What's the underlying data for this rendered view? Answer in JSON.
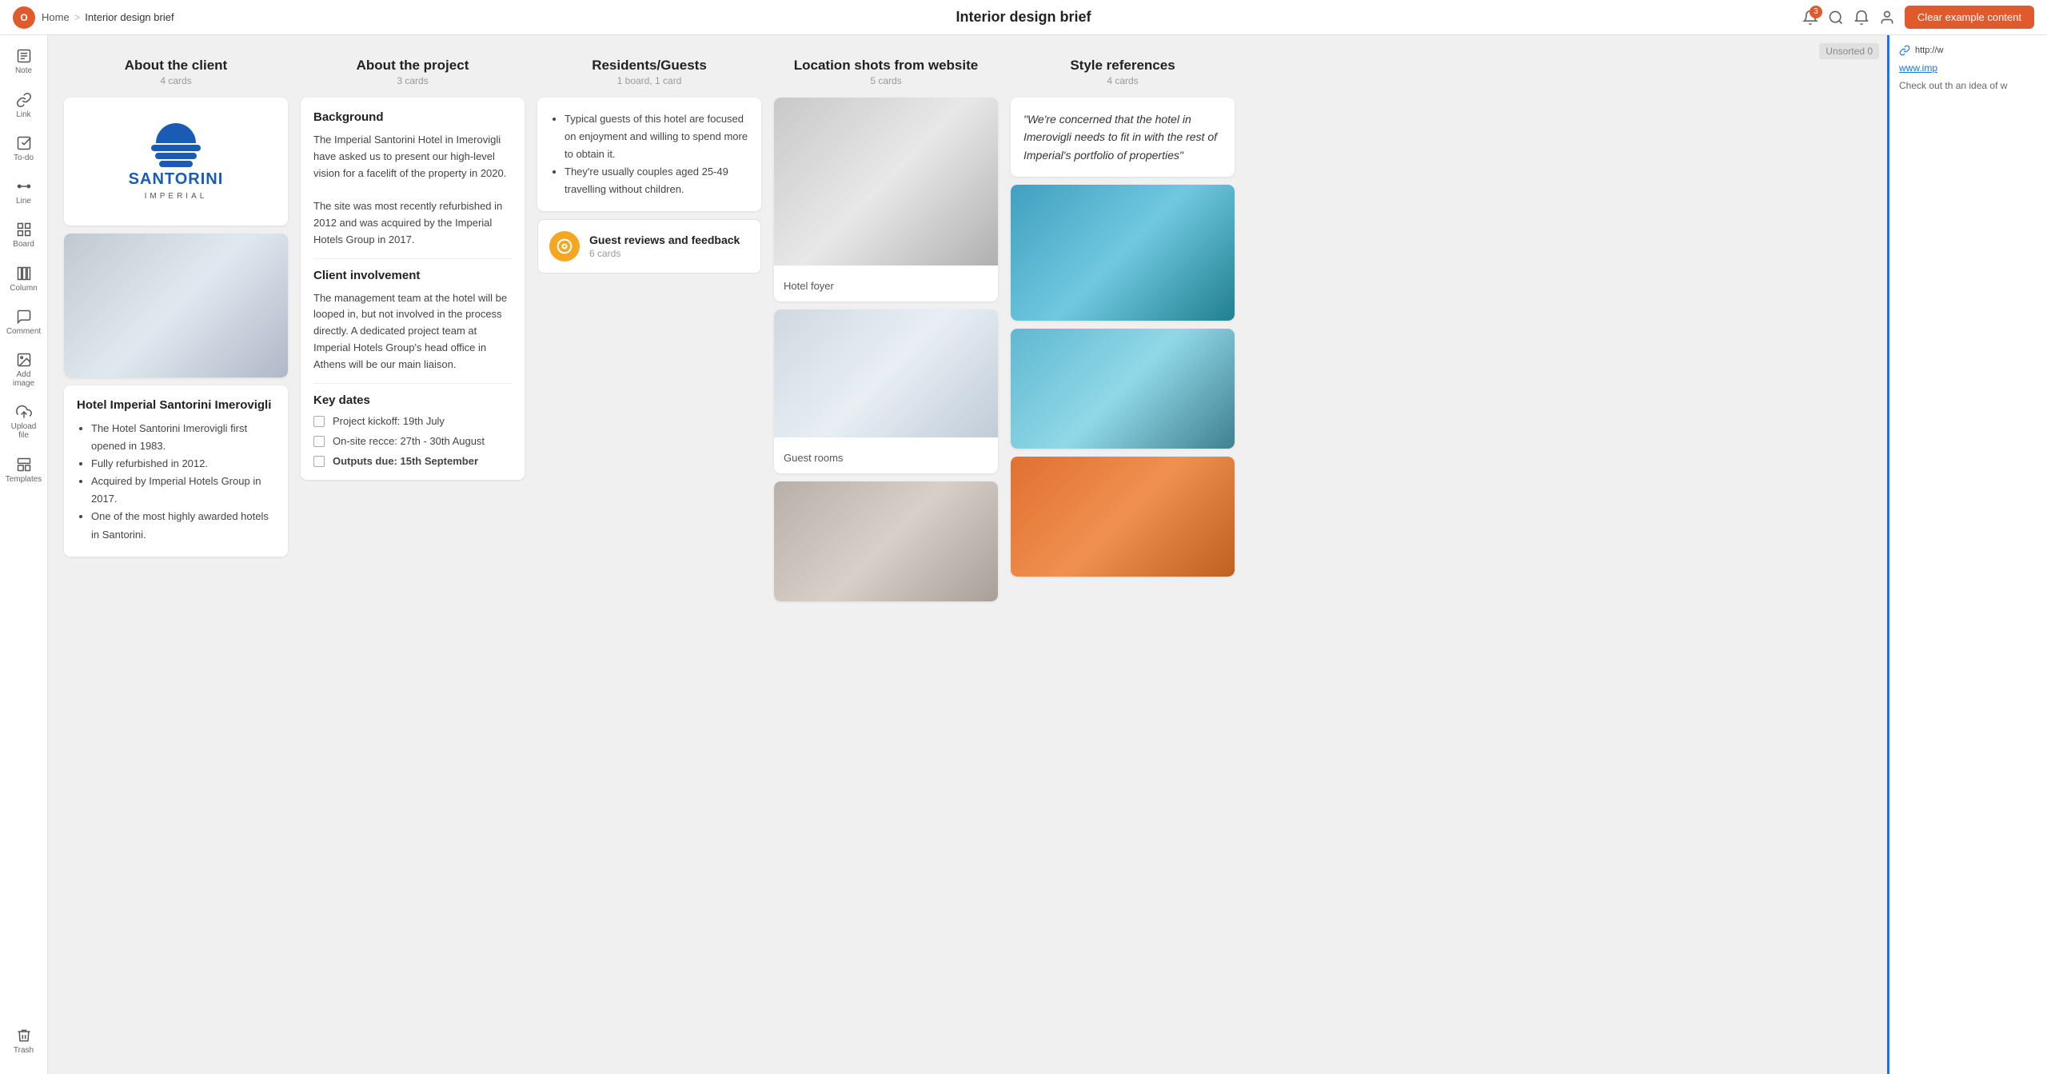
{
  "topnav": {
    "logo_text": "O",
    "breadcrumb_home": "Home",
    "breadcrumb_sep": ">",
    "breadcrumb_current": "Interior design brief",
    "page_title": "Interior design brief",
    "btn_clear_label": "Clear example content",
    "badge_count": "3"
  },
  "sidebar": {
    "items": [
      {
        "id": "note",
        "label": "Note",
        "icon": "📝"
      },
      {
        "id": "link",
        "label": "Link",
        "icon": "🔗"
      },
      {
        "id": "todo",
        "label": "To-do",
        "icon": "☑️"
      },
      {
        "id": "line",
        "label": "Line",
        "icon": "➖"
      },
      {
        "id": "board",
        "label": "Board",
        "icon": "⊞"
      },
      {
        "id": "column",
        "label": "Column",
        "icon": "▦"
      },
      {
        "id": "comment",
        "label": "Comment",
        "icon": "💬"
      },
      {
        "id": "add-image",
        "label": "Add image",
        "icon": "🖼️"
      },
      {
        "id": "upload",
        "label": "Upload file",
        "icon": "⬆️"
      },
      {
        "id": "templates",
        "label": "Templates",
        "icon": "🧩"
      }
    ],
    "trash_label": "Trash",
    "trash_icon": "🗑️"
  },
  "unsorted": "Unsorted 0",
  "columns": [
    {
      "id": "about-client",
      "title": "About the client",
      "subtitle": "4 cards",
      "cards": [
        {
          "type": "logo",
          "alt": "Santorini Imperial logo"
        },
        {
          "type": "image",
          "img_class": "img-interior",
          "label": ""
        },
        {
          "type": "text",
          "heading": "Hotel Imperial Santorini Imerovigli",
          "bullets": [
            "The Hotel Santorini Imerovigli first opened in 1983.",
            "Fully refurbished in 2012.",
            "Acquired by Imperial Hotels Group in 2017.",
            "One of the most highly awarded hotels in Santorini."
          ]
        }
      ]
    },
    {
      "id": "about-project",
      "title": "About the project",
      "subtitle": "3 cards",
      "cards": [
        {
          "type": "sections",
          "sections": [
            {
              "heading": "Background",
              "text": "The Imperial Santorini Hotel in Imerovigli have asked us to present our high-level vision for a facelift of the property in 2020.\n\nThe site was most recently refurbished in 2012 and was acquired by the Imperial Hotels Group in 2017."
            },
            {
              "heading": "Client involvement",
              "text": "The management team at the hotel will be looped in, but not involved in the process directly. A dedicated project team at Imperial Hotels Group's head office in Athens will be our main liaison."
            },
            {
              "heading": "Key dates",
              "checklist": [
                {
                  "label": "Project kickoff: 19th July",
                  "bold": false
                },
                {
                  "label": "On-site recce: 27th - 30th August",
                  "bold": false
                },
                {
                  "label": "Outputs due: 15th September",
                  "bold": true
                }
              ]
            }
          ]
        }
      ]
    },
    {
      "id": "residents-guests",
      "title": "Residents/Guests",
      "subtitle": "1 board, 1 card",
      "cards": [
        {
          "type": "bullets",
          "bullets": [
            "Typical guests of this hotel are focused on enjoyment and willing to spend more to obtain it.",
            "They're usually couples aged 25-49 travelling without children."
          ]
        },
        {
          "type": "linked",
          "icon_color": "#f5a623",
          "title": "Guest reviews and feedback",
          "subtitle": "6 cards"
        }
      ]
    },
    {
      "id": "location-shots",
      "title": "Location shots from website",
      "subtitle": "5 cards",
      "cards": [
        {
          "type": "image-labeled",
          "img_class": "img-hotel-foyer",
          "label": "Hotel foyer"
        },
        {
          "type": "image-labeled",
          "img_class": "img-guest-rooms",
          "label": "Guest rooms"
        },
        {
          "type": "image",
          "img_class": "img-restaurant",
          "label": ""
        }
      ]
    },
    {
      "id": "style-references",
      "title": "Style references",
      "subtitle": "4 cards",
      "cards": [
        {
          "type": "quote",
          "text": "\"We're concerned that the hotel in Imerovigli needs to fit in with the rest of Imperial's portfolio of properties\""
        },
        {
          "type": "image",
          "img_class": "img-pool-resort",
          "label": ""
        },
        {
          "type": "image",
          "img_class": "img-waterfront",
          "label": ""
        },
        {
          "type": "image",
          "img_class": "img-island",
          "label": ""
        }
      ]
    }
  ],
  "right_panel": {
    "link_prefix": "http://w",
    "link_text": "www.imp",
    "description": "Check out th an idea of w"
  }
}
